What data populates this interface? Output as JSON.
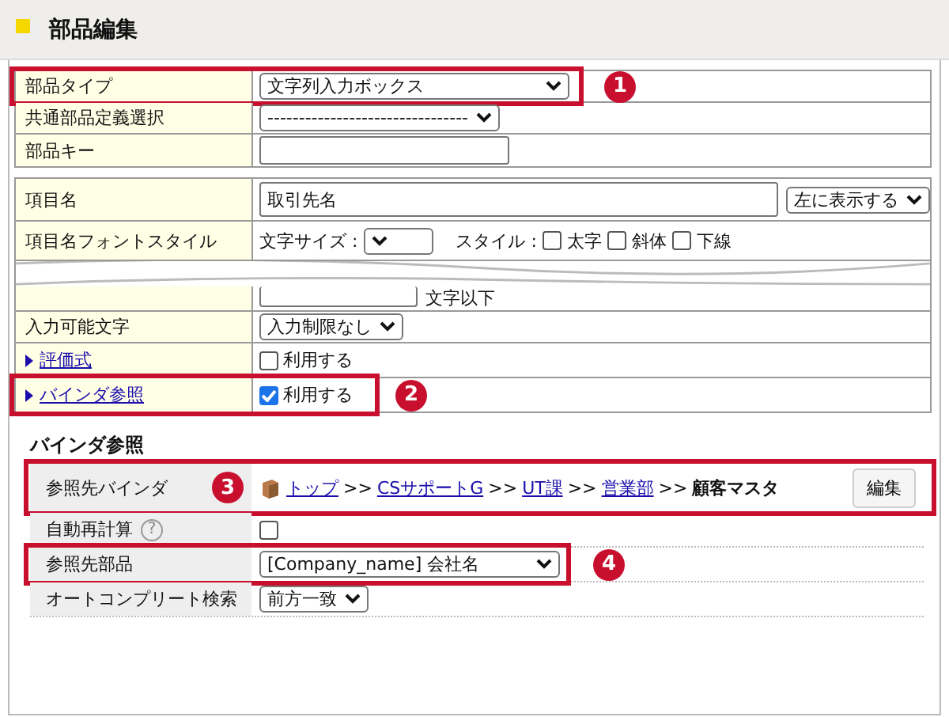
{
  "header": {
    "title": "部品編集"
  },
  "form_rows": [
    {
      "kind": "select",
      "label": "部品タイプ",
      "value": "文字列入力ボックス",
      "callout": "1"
    },
    {
      "kind": "select",
      "label": "共通部品定義選択",
      "value": "--------------------------------"
    },
    {
      "kind": "text",
      "label": "部品キー"
    }
  ],
  "item_rows": [
    {
      "kind": "name",
      "label": "項目名",
      "value": "取引先名",
      "position": "左に表示する"
    },
    {
      "kind": "font",
      "label": "項目名フォントスタイル",
      "size_label": "文字サイズ :",
      "style_label": "スタイル :",
      "styles": [
        {
          "label": "太字",
          "checked": false
        },
        {
          "label": "斜体",
          "checked": false
        },
        {
          "label": "下線",
          "checked": false
        }
      ]
    },
    {
      "kind": "break",
      "suffix": "文字以下"
    },
    {
      "kind": "select",
      "label": "入力可能文字",
      "value": "入力制限なし"
    },
    {
      "kind": "link_check",
      "label": "評価式",
      "check_label": "利用する",
      "checked": false
    },
    {
      "kind": "link_check",
      "label": "バインダ参照",
      "check_label": "利用する",
      "checked": true,
      "callout": "2"
    }
  ],
  "binder": {
    "title": "バインダ参照",
    "rows": [
      {
        "kind": "path",
        "label": "参照先バインダ",
        "callout": "3",
        "crumbs": [
          {
            "kind": "link",
            "text": "トップ"
          },
          {
            "kind": "sep",
            "text": ">>"
          },
          {
            "kind": "link",
            "text": "CSサポートG"
          },
          {
            "kind": "sep",
            "text": ">>"
          },
          {
            "kind": "link",
            "text": "UT課"
          },
          {
            "kind": "sep",
            "text": ">>"
          },
          {
            "kind": "link",
            "text": "営業部"
          },
          {
            "kind": "sep",
            "text": ">>"
          },
          {
            "kind": "current",
            "text": "顧客マスタ"
          }
        ],
        "button": "編集"
      },
      {
        "kind": "check",
        "label": "自動再計算",
        "help": "?",
        "checked": false
      },
      {
        "kind": "select",
        "label": "参照先部品",
        "value": "[Company_name] 会社名",
        "callout": "4"
      },
      {
        "kind": "select",
        "label": "オートコンプリート検索",
        "value": "前方一致"
      }
    ]
  }
}
